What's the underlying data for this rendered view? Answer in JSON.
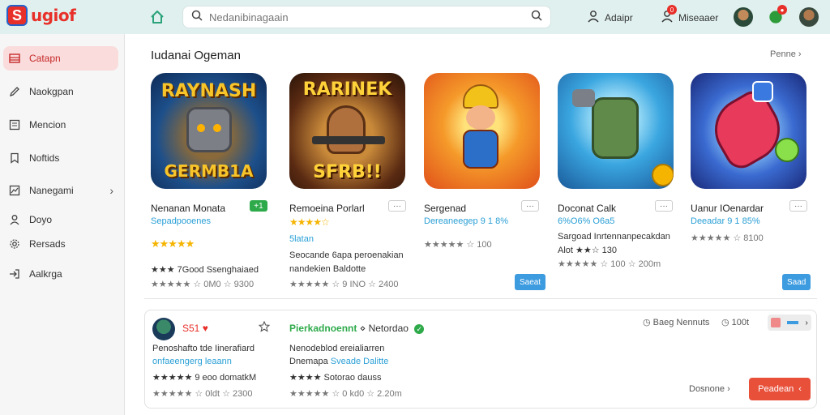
{
  "app": {
    "logo_letter": "S",
    "logo_text": "ugiof"
  },
  "search": {
    "placeholder": "Nedanibinagaain"
  },
  "header": {
    "user_label": "Adaipr",
    "messages_label": "Miseaaer",
    "message_badge": "0",
    "avatar_badge": "●"
  },
  "sidebar": {
    "items": [
      {
        "label": "Catapn",
        "icon": "grid-icon",
        "active": true
      },
      {
        "label": "Naokgpan",
        "icon": "pen-icon"
      },
      {
        "label": "Mencion",
        "icon": "list-icon"
      },
      {
        "label": "Noftids",
        "icon": "bookmark-icon"
      },
      {
        "label": "Nanegami",
        "icon": "chart-icon",
        "chevron": "›"
      },
      {
        "label": "Doyo",
        "icon": "user-icon"
      },
      {
        "label": "Rersads",
        "icon": "gear-icon"
      },
      {
        "label": "Aalkrga",
        "icon": "signin-icon"
      }
    ]
  },
  "section": {
    "title": "Iudanai Ogeman",
    "more": "Penne ›"
  },
  "games": [
    {
      "art_title": "RAYNASH",
      "art_bottom": "GERMB1A",
      "name": "Nenanan Monata",
      "sub": "Sepadpooenes",
      "stars": "★★★★★",
      "badge": "+1",
      "line1": "★★★ 7Good Ssenghaiaed",
      "line2": "★★★★★ ☆ 0M0 ☆ 9300"
    },
    {
      "art_title": "RARINEK",
      "art_bottom": "SFRB!!",
      "name": "Remoeina Porlarl",
      "sub": "★★★★☆",
      "more": "···",
      "sub2": "5latan",
      "line1": "Seocande 6apa peroenakian",
      "line2": "nandekien Baldotte",
      "line3": "★★★★★ ☆ 9 INO ☆ 2400"
    },
    {
      "name": "Sergenad",
      "sub": "Dereaneegep 9 1 8%",
      "more": "···",
      "line1": "★★★★★ ☆ 100",
      "btn": "Saeat"
    },
    {
      "name": "Doconat Calk",
      "sub": "6%O6% O6a5",
      "more": "···",
      "line1": "Sargoad Inrtennanpecakdan",
      "line2": "Alot ★★☆ 130",
      "line3": "★★★★★ ☆ 100 ☆ 200m"
    },
    {
      "name": "Uanur IOenardar",
      "sub": "Deeadar 9 1 85%",
      "more": "···",
      "line1": "★★★★★ ☆ 8100",
      "btn": "Saad"
    }
  ],
  "panel": {
    "user_score": "S51",
    "user_heart": "♥",
    "title_green": "Pierkadnoennt",
    "title_rest": "Netordao",
    "meta1": "Baeg Nennuts",
    "meta2": "100t",
    "left_line1": "Penoshafto tde Iinerafiard",
    "left_line2": "onfaeengerg leaann",
    "left_line3": "★★★★★ 9 eoo domatkM",
    "left_line4": "★★★★★ ☆ 0ldt ☆ 2300",
    "mid_line1": "Nenodeblod ereialiarren",
    "mid_line2": "Dnemapa",
    "mid_line2b": "Sveade Dalitte",
    "mid_line3": "★★★★ Sotorao dauss",
    "mid_line4": "★★★★★ ☆ 0 kd0 ☆ 2.20m",
    "more_link": "Dosnone ›",
    "action_btn": "Peadean"
  },
  "colors": {
    "accent": "#e8503a",
    "brand": "#e8302a",
    "link": "#2a9fd6",
    "star": "#f5b400",
    "topbar": "#dff0ee"
  }
}
